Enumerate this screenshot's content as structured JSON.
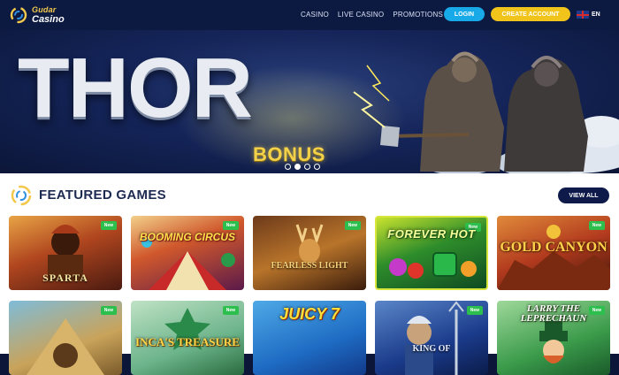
{
  "header": {
    "logo_line1": "Gudar",
    "logo_line2": "Casino",
    "nav": [
      "CASINO",
      "LIVE CASINO",
      "PROMOTIONS"
    ],
    "login_label": "LOGIN",
    "create_label": "CREATE ACCOUNT",
    "language": "EN"
  },
  "hero": {
    "title": "THOR",
    "subtitle": "BONUS",
    "slide_count": 4,
    "active_slide": 1
  },
  "featured": {
    "title": "FEATURED GAMES",
    "view_all_label": "VIEW ALL",
    "new_badge": "New",
    "games": [
      {
        "name": "SPARTA",
        "new": true
      },
      {
        "name": "BOOMING CIRCUS",
        "new": true
      },
      {
        "name": "FEARLESS LIGHT",
        "new": true
      },
      {
        "name": "FOREVER HOT",
        "new": true
      },
      {
        "name": "GOLD CANYON",
        "new": true
      },
      {
        "name": "",
        "new": true
      },
      {
        "name": "INCA'S TREASURE",
        "new": true
      },
      {
        "name": "JUICY 7",
        "new": false
      },
      {
        "name": "KING OF",
        "new": true
      },
      {
        "name": "LARRY THE LEPRECHAUN",
        "new": true
      }
    ]
  },
  "colors": {
    "header_bg": "#0c1a42",
    "login": "#17a9e8",
    "create_account": "#f0c41b",
    "view_all": "#0d1a4a",
    "new_badge": "#2dbf4d"
  }
}
